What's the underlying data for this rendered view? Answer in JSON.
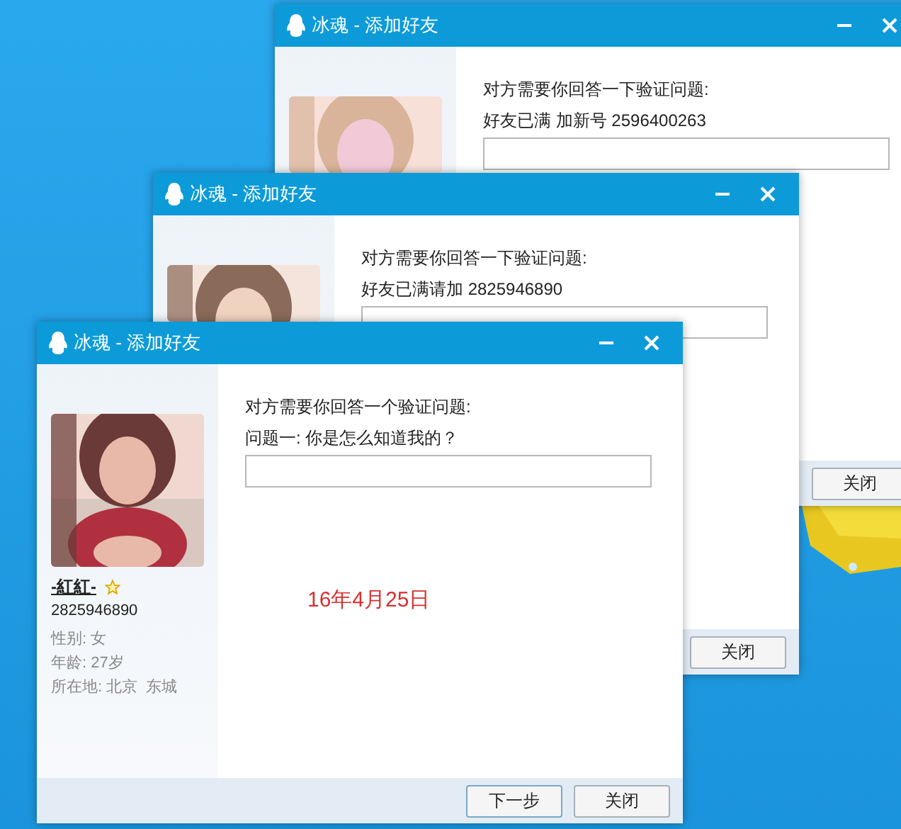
{
  "windows": [
    {
      "title": "冰魂 - 添加好友",
      "heading": "对方需要你回答一下验证问题:",
      "question": "好友已满 加新号 2596400263",
      "buttons": [
        {
          "label": "关闭",
          "kind": "close"
        }
      ]
    },
    {
      "title": "冰魂 - 添加好友",
      "heading": "对方需要你回答一下验证问题:",
      "question": "好友已满请加 2825946890",
      "buttons": [
        {
          "label": "关闭",
          "kind": "close"
        }
      ]
    },
    {
      "title": "冰魂 - 添加好友",
      "heading": "对方需要你回答一个验证问题:",
      "question": "问题一: 你是怎么知道我的？",
      "buttons": [
        {
          "label": "下一步",
          "kind": "next"
        },
        {
          "label": "关闭",
          "kind": "close"
        }
      ],
      "profile": {
        "name": "-紅紅-",
        "number": "2825946890",
        "details": [
          "性别: 女",
          "年龄: 27岁",
          "所在地: 北京  东城"
        ]
      },
      "annotation": "16年4月25日"
    }
  ]
}
